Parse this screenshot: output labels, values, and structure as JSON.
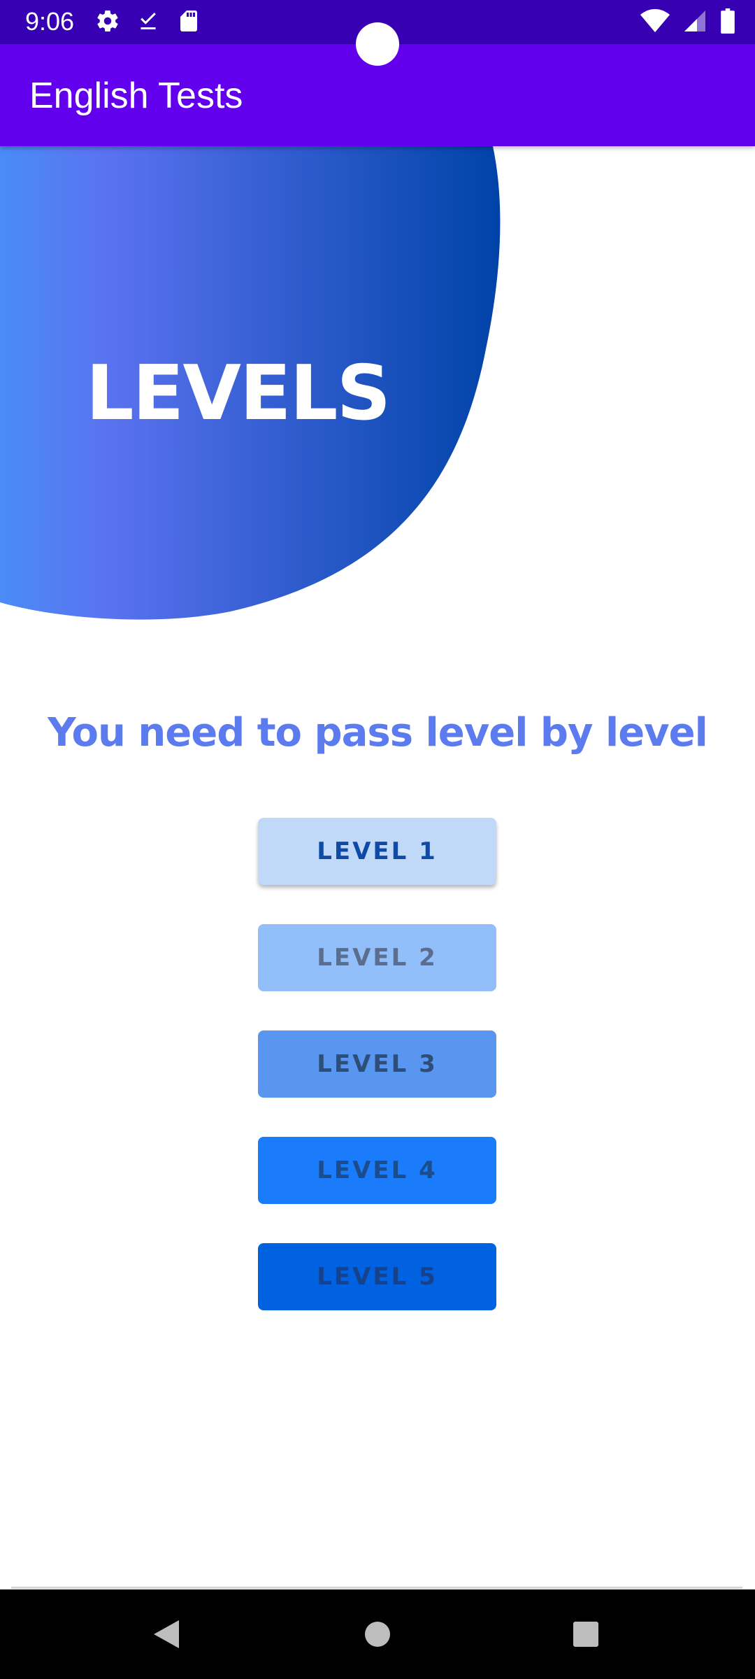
{
  "status_bar": {
    "time": "9:06",
    "left_icons": [
      "settings-gear-icon",
      "download-done-icon",
      "sd-card-icon"
    ],
    "right_icons": [
      "wifi-icon",
      "cell-signal-icon",
      "battery-icon"
    ]
  },
  "app_bar": {
    "title": "English Tests"
  },
  "banner": {
    "title": "LEVELS"
  },
  "main": {
    "subtitle": "You need to pass level by level",
    "levels": [
      {
        "label": "LEVEL 1"
      },
      {
        "label": "LEVEL 2"
      },
      {
        "label": "LEVEL 3"
      },
      {
        "label": "LEVEL 4"
      },
      {
        "label": "LEVEL 5"
      }
    ]
  },
  "nav_bar": {
    "icons": [
      "back-icon",
      "home-icon",
      "recents-icon"
    ]
  },
  "colors": {
    "status_bar": "#3700b3",
    "app_bar": "#6200ee",
    "subtitle": "#5b7bef",
    "level_1": "#c0d9f9",
    "level_2": "#92bef9",
    "level_3": "#5896ef",
    "level_4": "#1a7cfa",
    "level_5": "#0062e1"
  }
}
